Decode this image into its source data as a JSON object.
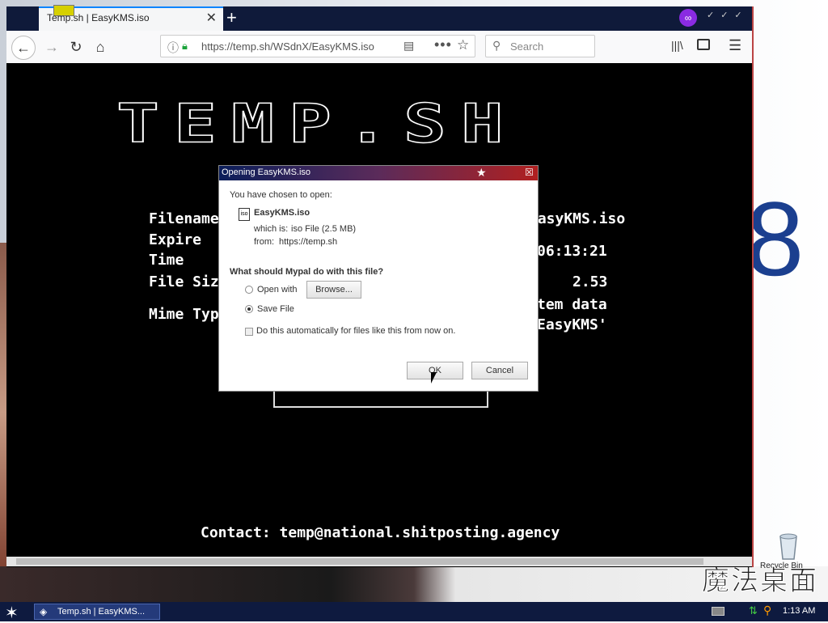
{
  "browser": {
    "tab_title": "Temp.sh | EasyKMS.iso",
    "url": "https://temp.sh/WSdnX/EasyKMS.iso",
    "search_placeholder": "Search"
  },
  "page": {
    "logo": "TEMP.SH",
    "filename_label": "Filename",
    "filename_value": "EasyKMS.iso",
    "expire_label": "Expire",
    "time_label": "Time",
    "time_value": "06:13:21",
    "filesize_label": "File Size",
    "filesize_value": "2.53",
    "mime_label": "Mime Type",
    "mime_value_1": "tem data",
    "mime_value_2": "EasyKMS'",
    "contact": "Contact: temp@national.shitposting.agency"
  },
  "dialog": {
    "title": "Opening EasyKMS.iso",
    "chosen_text": "You have chosen to open:",
    "file_name": "EasyKMS.iso",
    "which_is_label": "which is:",
    "which_is_value": "iso File (2.5 MB)",
    "from_label": "from:",
    "from_value": "https://temp.sh",
    "question": "What should Mypal do with this file?",
    "open_with_label": "Open with",
    "browse_label": "Browse...",
    "save_file_label": "Save File",
    "auto_label": "Do this automatically for files like this from now on.",
    "ok_label": "OK",
    "cancel_label": "Cancel",
    "selected_action": "Save File"
  },
  "desktop": {
    "recycle_label": "Recycle Bin",
    "watermark": "魔法桌面"
  },
  "taskbar": {
    "task_label": "Temp.sh | EasyKMS...",
    "clock": "1:13 AM"
  },
  "colors": {
    "accent": "#0a84ff",
    "secure_lock": "#1aa33a",
    "taskbar_bg": "#0e1a3f"
  }
}
